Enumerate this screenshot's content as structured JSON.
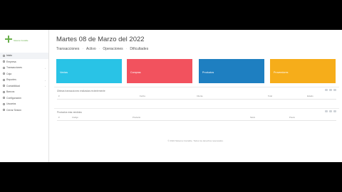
{
  "header": {
    "title": "Martes 08 de Marzo del 2022",
    "meta": [
      "Transacciones",
      "Activo",
      "Operaciones",
      "Dificultades"
    ]
  },
  "sidebar": {
    "logo_text": "Sistema Contable",
    "items": [
      {
        "label": "Inicio",
        "icon": "home-icon",
        "has_arrow": false
      },
      {
        "label": "Empresa",
        "icon": "building-icon",
        "has_arrow": false
      },
      {
        "label": "Transacciones",
        "icon": "exchange-icon",
        "has_arrow": true
      },
      {
        "label": "Caja",
        "icon": "cash-icon",
        "has_arrow": false
      },
      {
        "label": "Reportes",
        "icon": "report-icon",
        "has_arrow": true
      },
      {
        "label": "Contabilidad",
        "icon": "book-icon",
        "has_arrow": true
      },
      {
        "label": "Bancos",
        "icon": "bank-icon",
        "has_arrow": false
      },
      {
        "label": "Configuración",
        "icon": "gear-icon",
        "has_arrow": false
      },
      {
        "label": "Usuarios",
        "icon": "user-icon",
        "has_arrow": false
      },
      {
        "label": "Cerrar Sesión",
        "icon": "logout-icon",
        "has_arrow": false
      }
    ]
  },
  "cards": [
    {
      "label": "Ventas",
      "sub": "",
      "color": "#29c3e6"
    },
    {
      "label": "Compras",
      "sub": "",
      "color": "#f2525e"
    },
    {
      "label": "Productos",
      "sub": "",
      "color": "#1e7fc1"
    },
    {
      "label": "Proveedores",
      "sub": "",
      "color": "#f6ad1a"
    }
  ],
  "panels": [
    {
      "title": "Últimas transacciones realizadas recientemente",
      "columns": [
        "#",
        "Fecha",
        "Cliente",
        "Total",
        "Estado"
      ]
    },
    {
      "title": "Productos más vendidos",
      "columns": [
        "#",
        "Código",
        "Producto",
        "Stock",
        "Precio"
      ]
    }
  ],
  "footer": "© 2022 Sistema Contable. Todos los derechos reservados."
}
